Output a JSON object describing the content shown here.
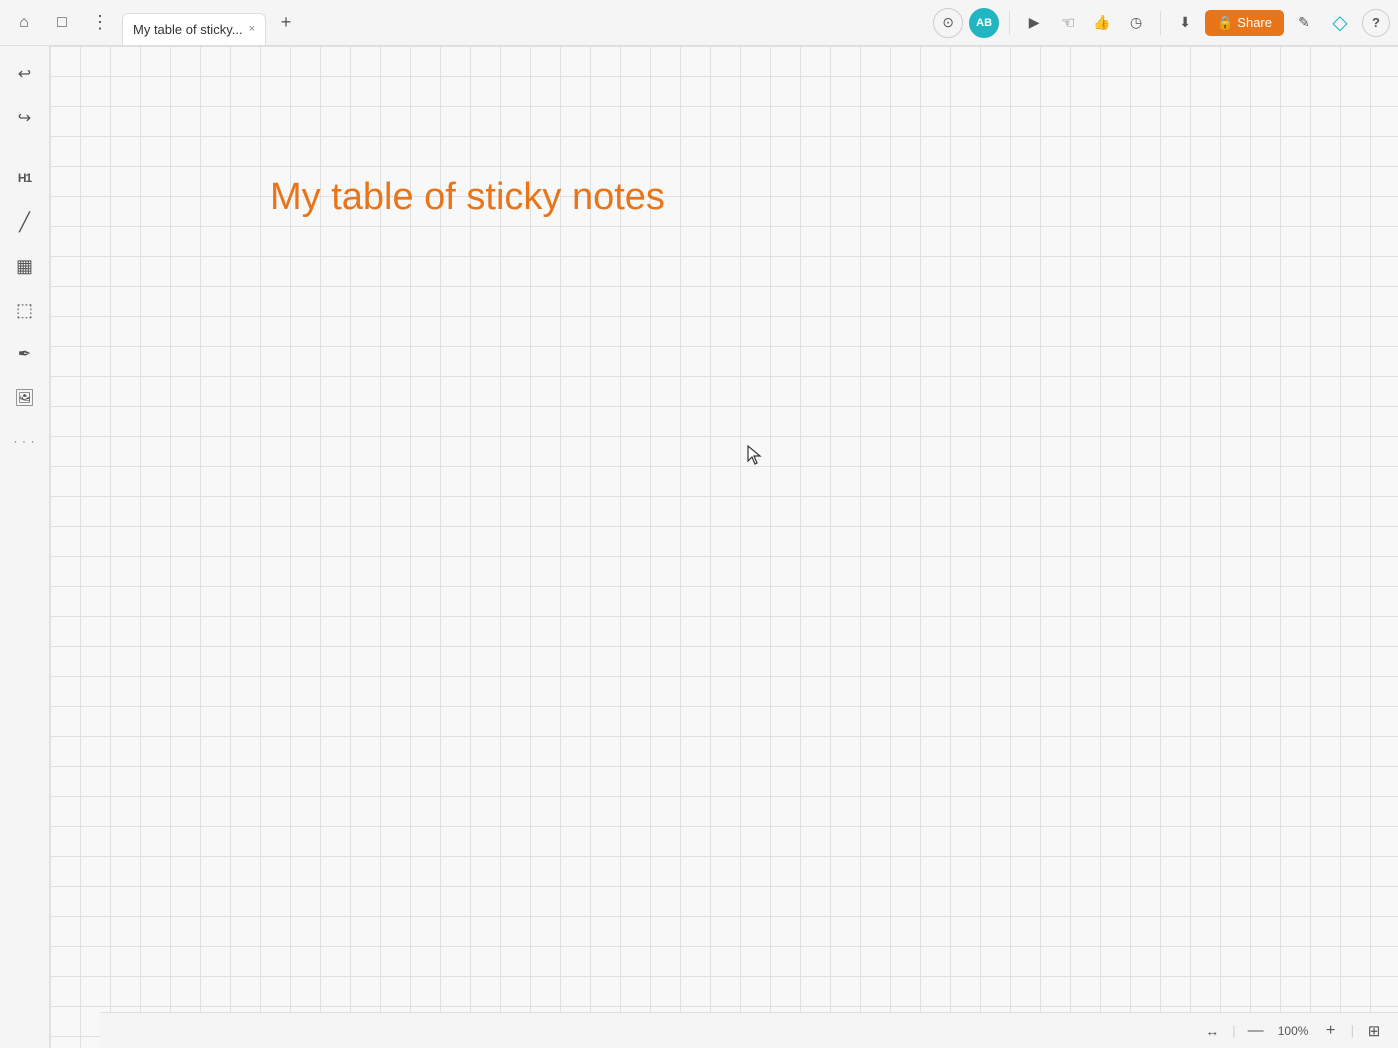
{
  "topbar": {
    "home_icon": "⌂",
    "window_icon": "□",
    "menu_icon": "⋮",
    "tab_title": "My table of sticky...",
    "tab_close": "×",
    "tab_add": "+",
    "target_icon": "◎",
    "avatar_label": "AB",
    "play_icon": "▶",
    "touch_icon": "☜",
    "thumb_icon": "👍",
    "clock_icon": "◷",
    "divider": "|",
    "download_icon": "↓",
    "lock_icon": "🔒",
    "share_label": "Share",
    "edit_icon": "✎",
    "diamond_icon": "◇",
    "help_label": "?"
  },
  "sidebar": {
    "tools": [
      {
        "name": "undo",
        "icon": "↩",
        "label": "Undo"
      },
      {
        "name": "redo",
        "icon": "↪",
        "label": "Redo"
      },
      {
        "name": "heading",
        "icon": "H1",
        "label": "Heading"
      },
      {
        "name": "line",
        "icon": "╱",
        "label": "Line"
      },
      {
        "name": "table",
        "icon": "▦",
        "label": "Table"
      },
      {
        "name": "sticky",
        "icon": "⬚",
        "label": "Sticky Note"
      },
      {
        "name": "pen",
        "icon": "✒",
        "label": "Pen"
      },
      {
        "name": "image",
        "icon": "🖼",
        "label": "Image"
      },
      {
        "name": "dots",
        "icon": "⠿",
        "label": "More"
      }
    ]
  },
  "canvas": {
    "title": "My table of sticky notes"
  },
  "bottombar": {
    "fit_icon": "↔",
    "zoom_minus": "—",
    "zoom_level": "100%",
    "zoom_plus": "+",
    "map_icon": "⊞"
  }
}
